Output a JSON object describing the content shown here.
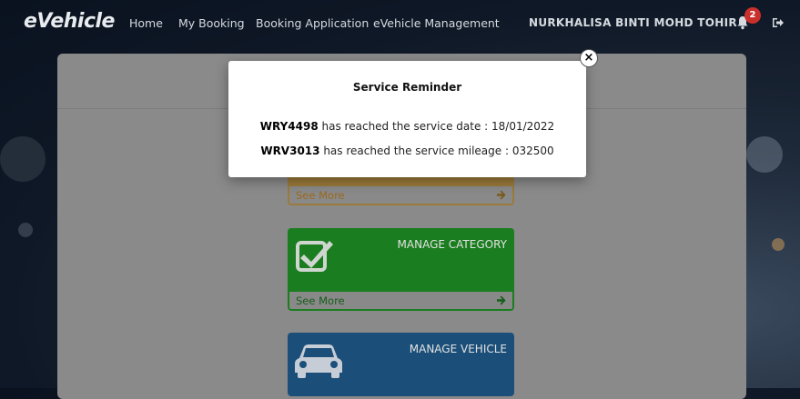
{
  "navbar": {
    "brand": "eVehicle",
    "links": [
      "Home",
      "My Booking",
      "Booking Application",
      "eVehicle Management"
    ],
    "user_name": "NURKHALISA BINTI MOHD TOHIR",
    "notification_count": "2",
    "bell_icon": "bell-icon",
    "logout_icon": "sign-out-icon"
  },
  "cards": [
    {
      "title": "",
      "see_more": "See More",
      "color": "#9b7a3a",
      "foot_text_color": "#9b6a1c"
    },
    {
      "title": "MANAGE CATEGORY",
      "see_more": "See More",
      "icon": "check-square-icon",
      "color": "#1a7d1f",
      "foot_text_color": "#145f18"
    },
    {
      "title": "MANAGE VEHICLE",
      "see_more": "",
      "icon": "car-icon",
      "color": "#1b4f79"
    }
  ],
  "modal": {
    "title": "Service Reminder",
    "lines": [
      {
        "plate": "WRY4498",
        "text": " has reached the service date : 18/01/2022"
      },
      {
        "plate": "WRV3013",
        "text": " has reached the service mileage : 032500"
      }
    ],
    "close_symbol": "×"
  }
}
